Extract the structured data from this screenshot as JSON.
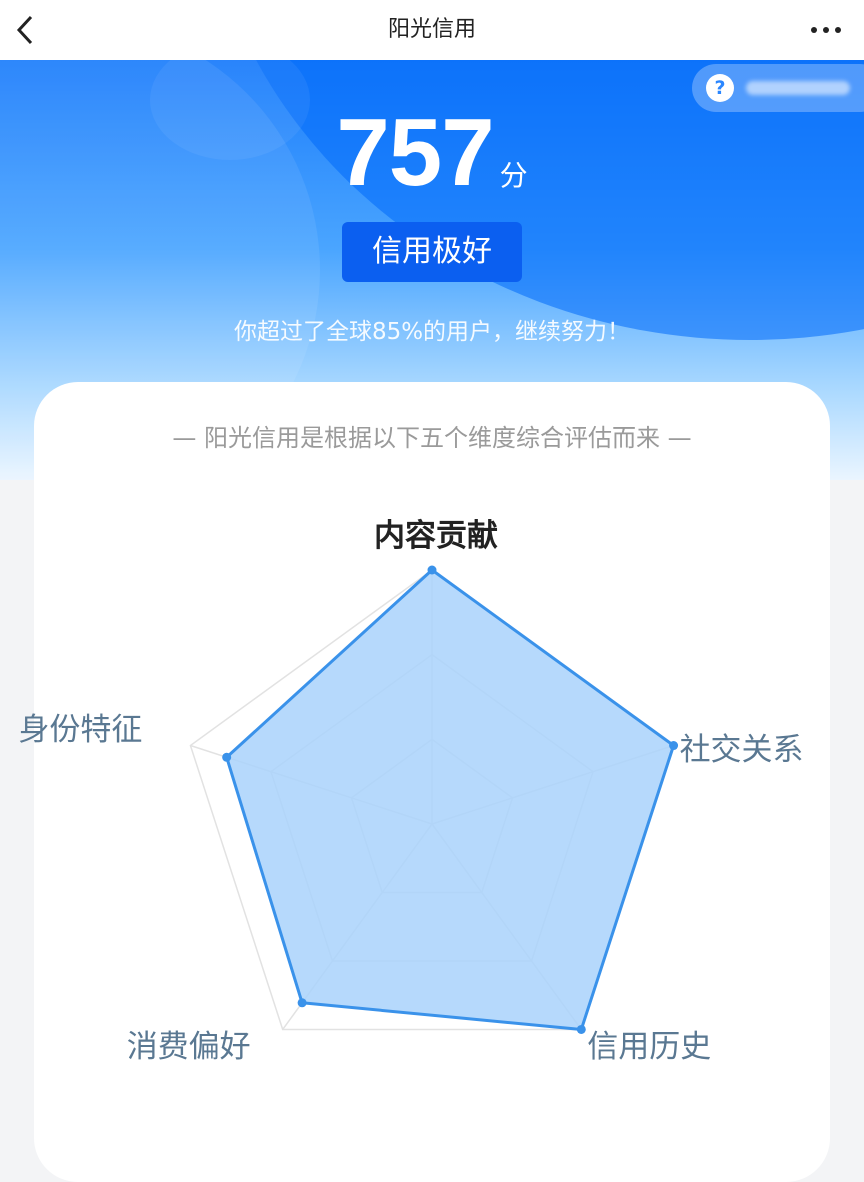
{
  "nav": {
    "title": "阳光信用"
  },
  "help": {
    "icon": "question-icon",
    "text": "?"
  },
  "score": {
    "value": "757",
    "unit": "分",
    "level": "信用极好",
    "tagline": "你超过了全球85%的用户，继续努力！"
  },
  "card": {
    "description": "— 阳光信用是根据以下五个维度综合评估而来 —"
  },
  "radar": {
    "dimensions": [
      {
        "key": "content",
        "label": "内容贡献",
        "value": 1.0
      },
      {
        "key": "social",
        "label": "社交关系",
        "value": 1.0
      },
      {
        "key": "history",
        "label": "信用历史",
        "value": 1.0
      },
      {
        "key": "preference",
        "label": "消费偏好",
        "value": 0.87
      },
      {
        "key": "identity",
        "label": "身份特征",
        "value": 0.85
      }
    ],
    "colors": {
      "fill": "#a9d2fb",
      "stroke": "#3a92ea",
      "grid": "#e2e2e2",
      "dot": "#3a92ea"
    }
  }
}
